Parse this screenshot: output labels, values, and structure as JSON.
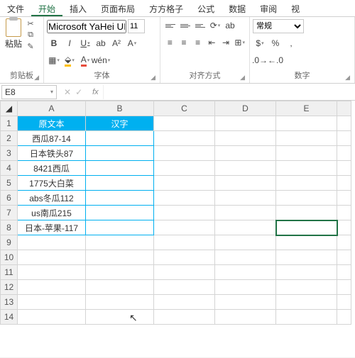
{
  "tabs": {
    "file": "文件",
    "home": "开始",
    "insert": "插入",
    "layout": "页面布局",
    "fangfang": "方方格子",
    "formula": "公式",
    "data": "数据",
    "review": "审阅",
    "view": "视"
  },
  "ribbon": {
    "clipboard": {
      "paste": "粘贴",
      "label": "剪贴板"
    },
    "font": {
      "name": "Microsoft YaHei UI",
      "size": "11",
      "bold": "B",
      "italic": "I",
      "underline": "U",
      "label": "字体",
      "ruby": "wén"
    },
    "align": {
      "wrap": "ab",
      "label": "对齐方式"
    },
    "number": {
      "format": "常规",
      "label": "数字",
      "percent": "%",
      "comma": ","
    }
  },
  "namebox": "E8",
  "cols": [
    "A",
    "B",
    "C",
    "D",
    "E"
  ],
  "rows": [
    "1",
    "2",
    "3",
    "4",
    "5",
    "6",
    "7",
    "8",
    "9",
    "10",
    "11",
    "12",
    "13",
    "14"
  ],
  "header": {
    "A": "原文本",
    "B": "汉字"
  },
  "data": {
    "2": "西瓜87-14",
    "3": "日本铁头87",
    "4": "8421西瓜",
    "5": "1775大白菜",
    "6": "abs冬瓜112",
    "7": "us南瓜215",
    "8": "日本-苹果-117"
  }
}
